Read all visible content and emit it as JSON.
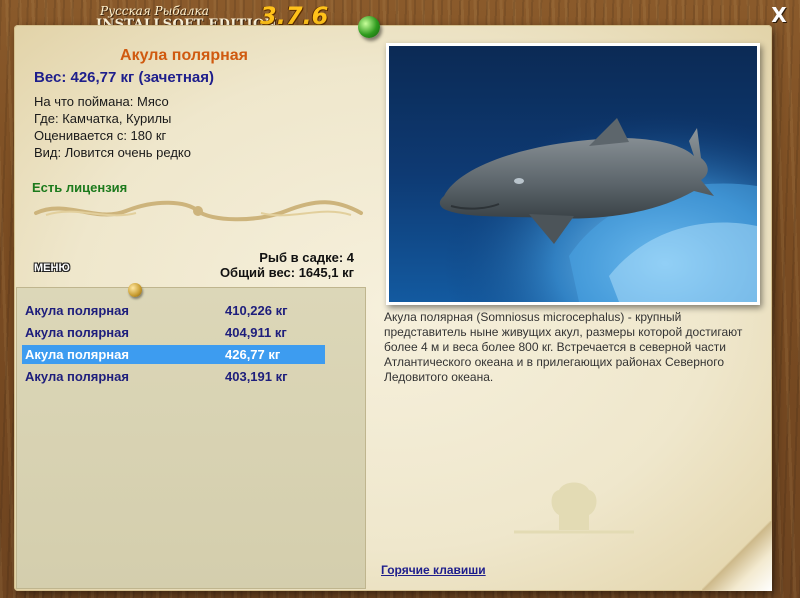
{
  "brand": {
    "line1": "Русская Рыбалка",
    "line2": "INSTALLSOFT EDITION",
    "version": "3.7.6"
  },
  "close_label": "X",
  "fish": {
    "title": "Акула полярная",
    "weight": "Вес: 426,77 кг (зачетная)",
    "caught_with": "На что поймана: Мясо",
    "location": "Где: Камчатка, Курилы",
    "valued_from": "Оценивается с: 180 кг",
    "rarity": "Вид: Ловится очень редко",
    "license": "Есть лицензия"
  },
  "stats": {
    "count": "Рыб в садке: 4",
    "total": "Общий вес: 1645,1 кг"
  },
  "menu_label": "МЕНЮ",
  "catch_list": [
    {
      "name": "Акула полярная",
      "weight": "410,226 кг"
    },
    {
      "name": "Акула полярная",
      "weight": "404,911 кг"
    },
    {
      "name": "Акула полярная",
      "weight": "426,77 кг"
    },
    {
      "name": "Акула полярная",
      "weight": "403,191 кг"
    }
  ],
  "selected_index": 2,
  "description": "Акула полярная (Somniosus microcephalus) - крупный представитель ныне живущих акул, размеры которой достигают более 4 м и веса более 800 кг. Встречается в северной части Атлантического океана и в прилегающих районах Северного Ледовитого океана.",
  "hotkeys_label": "Горячие клавиши",
  "colors": {
    "title": "#d05a10",
    "weight": "#1e1e8c",
    "license": "#1c7a1c",
    "selected_row": "#3d9cf0"
  }
}
